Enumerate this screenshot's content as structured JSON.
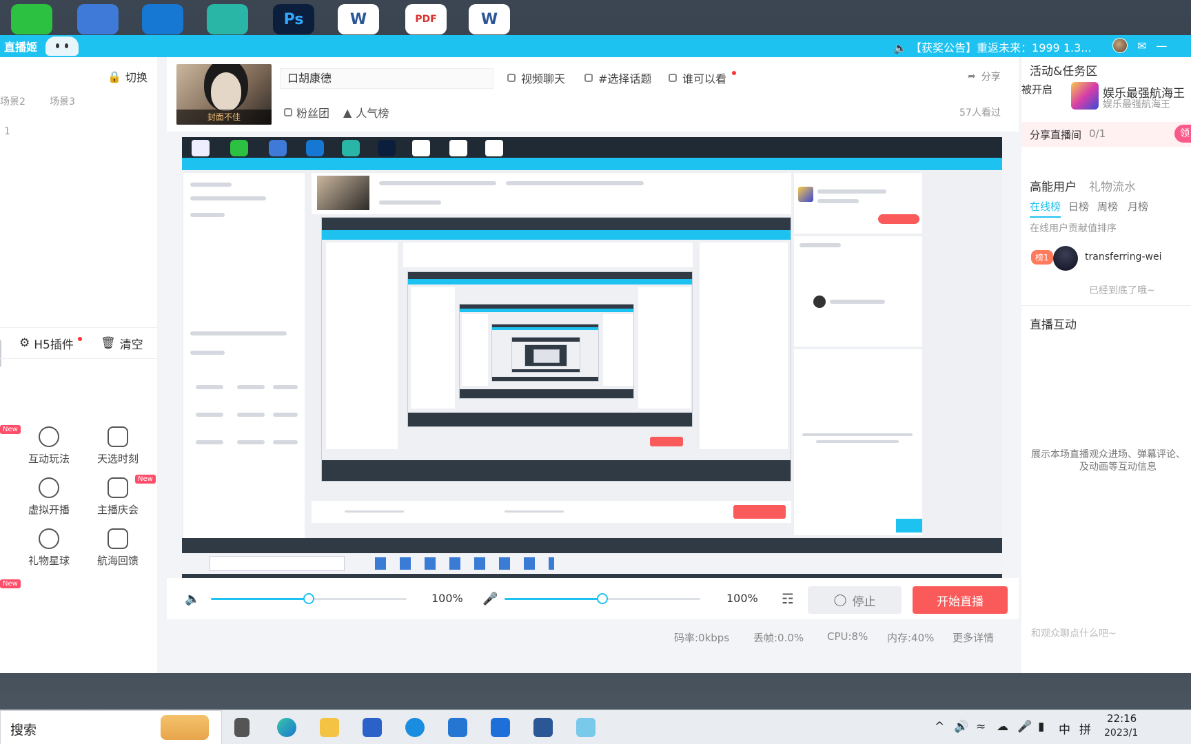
{
  "desktop": {
    "icons": [
      {
        "name": "wechat-icon",
        "label": "",
        "color": "#2cc140"
      },
      {
        "name": "notes-app-icon",
        "label": "",
        "color": "#3f7ad8"
      },
      {
        "name": "video-player-icon",
        "label": "",
        "color": "#1778d3"
      },
      {
        "name": "statue-of-liberty-icon",
        "label": "",
        "color": "#2ab6a6"
      },
      {
        "name": "photoshop-icon",
        "label": "Ps",
        "color": "#0b1e3c"
      },
      {
        "name": "word-doc-icon",
        "label": "W",
        "color": "#2b5797"
      },
      {
        "name": "pdf-icon",
        "label": "PDF",
        "color": "#d9322f"
      },
      {
        "name": "word-doc-icon-2",
        "label": "W",
        "color": "#2b5797"
      }
    ]
  },
  "app": {
    "logo": "直播姬",
    "announcement": "【获奖公告】重返未来：1999 1.3...",
    "accent": "#1ec2f0",
    "danger": "#fa5a5a"
  },
  "left": {
    "switch_label": "切换",
    "scenes": [
      "场景2",
      "场景3"
    ],
    "scene_row": "1",
    "h5_plugin": "H5插件",
    "clear": "清空",
    "tools": [
      {
        "label": "互动玩法",
        "icon": "no-sign-icon"
      },
      {
        "label": "天选时刻",
        "icon": "lucky-draw-icon"
      },
      {
        "label": "虚拟开播",
        "icon": "virtual-avatar-icon"
      },
      {
        "label": "主播庆会",
        "icon": "party-popper-icon"
      },
      {
        "label": "礼物星球",
        "icon": "planet-icon"
      },
      {
        "label": "航海回馈",
        "icon": "anchor-icon"
      }
    ],
    "new_badge": "New"
  },
  "header": {
    "cover_tag": "封面不佳",
    "room_title": "口胡康德",
    "video_chat": "视频聊天",
    "topic": "#选择话题",
    "visibility": "谁可以看",
    "share": "分享",
    "fans_group": "粉丝团",
    "popularity": "人气榜",
    "viewers": "57人看过"
  },
  "controls": {
    "speaker_volume": "100%",
    "mic_volume": "100%",
    "speaker_level": 0.5,
    "mic_level": 0.5,
    "stop": "停止",
    "start": "开始直播"
  },
  "stats": {
    "bitrate": "码率:0kbps",
    "drop": "丢帧:0.0%",
    "cpu": "CPU:8%",
    "memory": "内存:40%",
    "more": "更多详情"
  },
  "right": {
    "activity_title": "活动&任务区",
    "promo_left": "被开启",
    "promo_title": "娱乐最强航海王",
    "promo_sub": "娱乐最强航海王",
    "share_live": "分享直播间",
    "share_count": "0/1",
    "claim": "领",
    "tab_high_users": "高能用户",
    "tab_gift_flow": "礼物流水",
    "subtabs": [
      "在线榜",
      "日榜",
      "周榜",
      "月榜"
    ],
    "online_sort": "在线用户贡献值排序",
    "rank_badge": "榜1",
    "rank_user": "transferring-wei",
    "end_text": "已经到底了哦~",
    "interaction_title": "直播互动",
    "interaction_hint_1": "展示本场直播观众进场、弹幕评论、",
    "interaction_hint_2": "及动画等互动信息",
    "chat_placeholder": "和观众聊点什么吧~"
  },
  "taskbar": {
    "search": "搜索",
    "ime": "中",
    "ime2": "拼",
    "time": "22:16",
    "date": "2023/1"
  }
}
